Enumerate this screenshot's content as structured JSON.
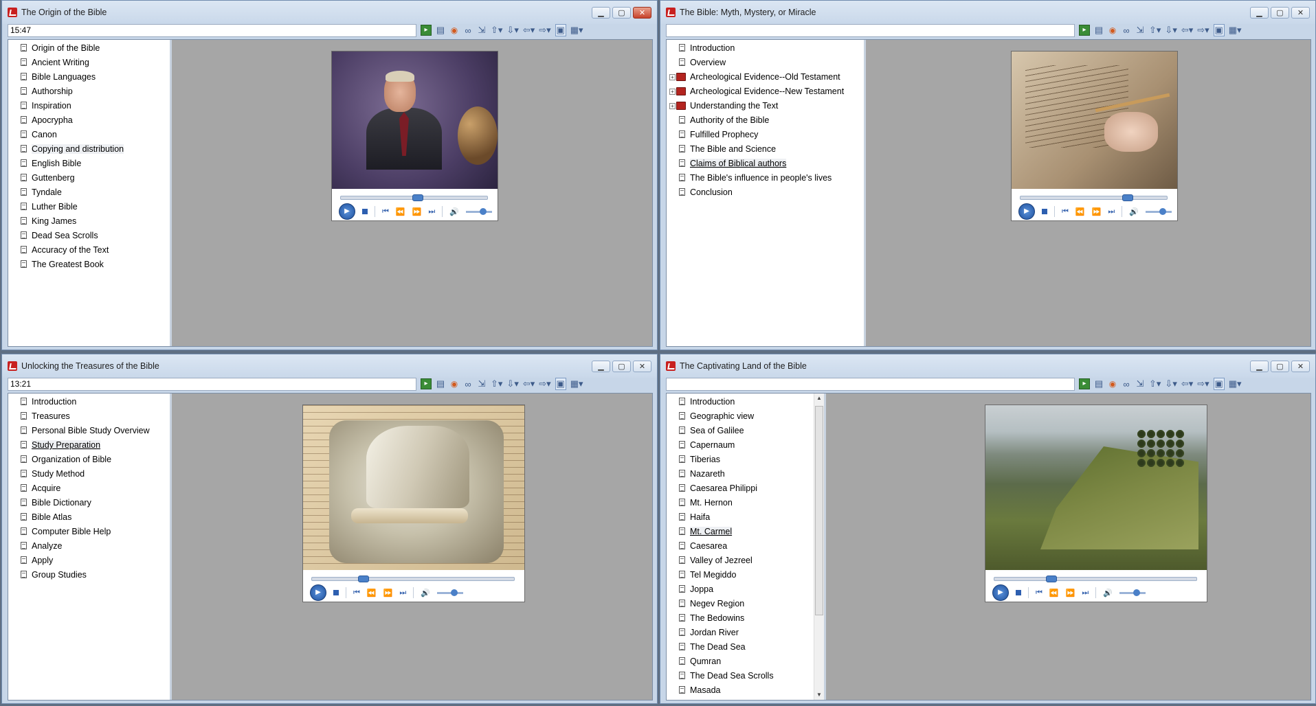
{
  "windows": [
    {
      "title": "The Origin of the Bible",
      "address": "15:47",
      "close_active": true,
      "toc": [
        {
          "label": "Origin of the Bible"
        },
        {
          "label": "Ancient Writing"
        },
        {
          "label": "Bible Languages"
        },
        {
          "label": "Authorship"
        },
        {
          "label": "Inspiration"
        },
        {
          "label": "Apocrypha"
        },
        {
          "label": "Canon"
        },
        {
          "label": "Copying and distribution",
          "state": "highlighted"
        },
        {
          "label": "English Bible"
        },
        {
          "label": "Guttenberg"
        },
        {
          "label": "Tyndale"
        },
        {
          "label": "Luther Bible"
        },
        {
          "label": "King James"
        },
        {
          "label": "Dead Sea Scrolls"
        },
        {
          "label": "Accuracy of the Text"
        },
        {
          "label": "The Greatest Book"
        }
      ],
      "video": {
        "scene": "speaker",
        "progress": 0.52
      }
    },
    {
      "title": "The Bible: Myth, Mystery, or Miracle",
      "address": "",
      "close_active": false,
      "toc": [
        {
          "label": "Introduction"
        },
        {
          "label": "Overview"
        },
        {
          "label": "Archeological Evidence--Old Testament",
          "type": "book",
          "expandable": true
        },
        {
          "label": "Archeological Evidence--New Testament",
          "type": "book",
          "expandable": true
        },
        {
          "label": "Understanding the Text",
          "type": "book",
          "expandable": true
        },
        {
          "label": "Authority of the Bible"
        },
        {
          "label": "Fulfilled Prophecy"
        },
        {
          "label": "The Bible and Science"
        },
        {
          "label": "Claims of Biblical authors",
          "state": "underlined"
        },
        {
          "label": "The Bible's influence in people's lives"
        },
        {
          "label": "Conclusion"
        }
      ],
      "video": {
        "scene": "scroll",
        "progress": 0.73
      }
    },
    {
      "title": "Unlocking the Treasures of the Bible",
      "address": "13:21",
      "close_active": false,
      "toc": [
        {
          "label": "Introduction"
        },
        {
          "label": "Treasures"
        },
        {
          "label": "Personal Bible Study Overview"
        },
        {
          "label": "Study Preparation",
          "state": "underlined"
        },
        {
          "label": "Organization of Bible"
        },
        {
          "label": "Study Method"
        },
        {
          "label": "Acquire"
        },
        {
          "label": "Bible Dictionary"
        },
        {
          "label": "Bible Atlas"
        },
        {
          "label": "Computer Bible Help"
        },
        {
          "label": "Analyze"
        },
        {
          "label": "Apply"
        },
        {
          "label": "Group Studies"
        }
      ],
      "video": {
        "scene": "scribe",
        "progress": 0.25
      }
    },
    {
      "title": "The Captivating Land of the Bible",
      "address": "",
      "close_active": false,
      "toc": [
        {
          "label": "Introduction"
        },
        {
          "label": "Geographic view"
        },
        {
          "label": "Sea of Galilee"
        },
        {
          "label": "Capernaum"
        },
        {
          "label": "Tiberias"
        },
        {
          "label": "Nazareth"
        },
        {
          "label": "Caesarea Philippi"
        },
        {
          "label": "Mt. Hernon"
        },
        {
          "label": "Haifa"
        },
        {
          "label": "Mt. Carmel",
          "state": "underlined"
        },
        {
          "label": "Caesarea"
        },
        {
          "label": "Valley of Jezreel"
        },
        {
          "label": "Tel Megiddo"
        },
        {
          "label": "Joppa"
        },
        {
          "label": "Negev Region"
        },
        {
          "label": "The Bedowins"
        },
        {
          "label": "Jordan River"
        },
        {
          "label": "The Dead Sea"
        },
        {
          "label": "Qumran"
        },
        {
          "label": "The Dead Sea Scrolls"
        },
        {
          "label": "Masada"
        }
      ],
      "video": {
        "scene": "land",
        "progress": 0.28
      }
    }
  ],
  "icons": {
    "window_controls": [
      "minimize-icon",
      "maximize-icon",
      "close-icon"
    ],
    "toolbar": [
      "go-icon",
      "copy-icon",
      "record-icon",
      "link-icon",
      "resize-icon",
      "up-arrow-icon",
      "down-arrow-icon",
      "back-arrow-icon",
      "forward-arrow-icon",
      "layout-icon",
      "view-menu-icon"
    ],
    "player": [
      "play-icon",
      "stop-icon",
      "prev-icon",
      "rewind-icon",
      "fast-forward-icon",
      "next-icon",
      "volume-icon"
    ]
  },
  "colors": {
    "desktop": "#5f6f83",
    "window_frame": "#c7d6e8",
    "content_bg": "#a6a6a6",
    "accent": "#2d5fb0",
    "app_icon": "#c8201f"
  }
}
